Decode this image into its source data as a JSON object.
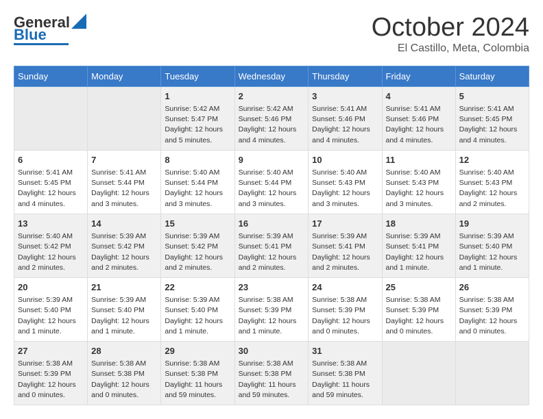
{
  "header": {
    "logo_line1": "General",
    "logo_line2": "Blue",
    "month_title": "October 2024",
    "location": "El Castillo, Meta, Colombia"
  },
  "weekdays": [
    "Sunday",
    "Monday",
    "Tuesday",
    "Wednesday",
    "Thursday",
    "Friday",
    "Saturday"
  ],
  "weeks": [
    [
      {
        "day": "",
        "info": ""
      },
      {
        "day": "",
        "info": ""
      },
      {
        "day": "1",
        "info": "Sunrise: 5:42 AM\nSunset: 5:47 PM\nDaylight: 12 hours and 5 minutes."
      },
      {
        "day": "2",
        "info": "Sunrise: 5:42 AM\nSunset: 5:46 PM\nDaylight: 12 hours and 4 minutes."
      },
      {
        "day": "3",
        "info": "Sunrise: 5:41 AM\nSunset: 5:46 PM\nDaylight: 12 hours and 4 minutes."
      },
      {
        "day": "4",
        "info": "Sunrise: 5:41 AM\nSunset: 5:46 PM\nDaylight: 12 hours and 4 minutes."
      },
      {
        "day": "5",
        "info": "Sunrise: 5:41 AM\nSunset: 5:45 PM\nDaylight: 12 hours and 4 minutes."
      }
    ],
    [
      {
        "day": "6",
        "info": "Sunrise: 5:41 AM\nSunset: 5:45 PM\nDaylight: 12 hours and 4 minutes."
      },
      {
        "day": "7",
        "info": "Sunrise: 5:41 AM\nSunset: 5:44 PM\nDaylight: 12 hours and 3 minutes."
      },
      {
        "day": "8",
        "info": "Sunrise: 5:40 AM\nSunset: 5:44 PM\nDaylight: 12 hours and 3 minutes."
      },
      {
        "day": "9",
        "info": "Sunrise: 5:40 AM\nSunset: 5:44 PM\nDaylight: 12 hours and 3 minutes."
      },
      {
        "day": "10",
        "info": "Sunrise: 5:40 AM\nSunset: 5:43 PM\nDaylight: 12 hours and 3 minutes."
      },
      {
        "day": "11",
        "info": "Sunrise: 5:40 AM\nSunset: 5:43 PM\nDaylight: 12 hours and 3 minutes."
      },
      {
        "day": "12",
        "info": "Sunrise: 5:40 AM\nSunset: 5:43 PM\nDaylight: 12 hours and 2 minutes."
      }
    ],
    [
      {
        "day": "13",
        "info": "Sunrise: 5:40 AM\nSunset: 5:42 PM\nDaylight: 12 hours and 2 minutes."
      },
      {
        "day": "14",
        "info": "Sunrise: 5:39 AM\nSunset: 5:42 PM\nDaylight: 12 hours and 2 minutes."
      },
      {
        "day": "15",
        "info": "Sunrise: 5:39 AM\nSunset: 5:42 PM\nDaylight: 12 hours and 2 minutes."
      },
      {
        "day": "16",
        "info": "Sunrise: 5:39 AM\nSunset: 5:41 PM\nDaylight: 12 hours and 2 minutes."
      },
      {
        "day": "17",
        "info": "Sunrise: 5:39 AM\nSunset: 5:41 PM\nDaylight: 12 hours and 2 minutes."
      },
      {
        "day": "18",
        "info": "Sunrise: 5:39 AM\nSunset: 5:41 PM\nDaylight: 12 hours and 1 minute."
      },
      {
        "day": "19",
        "info": "Sunrise: 5:39 AM\nSunset: 5:40 PM\nDaylight: 12 hours and 1 minute."
      }
    ],
    [
      {
        "day": "20",
        "info": "Sunrise: 5:39 AM\nSunset: 5:40 PM\nDaylight: 12 hours and 1 minute."
      },
      {
        "day": "21",
        "info": "Sunrise: 5:39 AM\nSunset: 5:40 PM\nDaylight: 12 hours and 1 minute."
      },
      {
        "day": "22",
        "info": "Sunrise: 5:39 AM\nSunset: 5:40 PM\nDaylight: 12 hours and 1 minute."
      },
      {
        "day": "23",
        "info": "Sunrise: 5:38 AM\nSunset: 5:39 PM\nDaylight: 12 hours and 1 minute."
      },
      {
        "day": "24",
        "info": "Sunrise: 5:38 AM\nSunset: 5:39 PM\nDaylight: 12 hours and 0 minutes."
      },
      {
        "day": "25",
        "info": "Sunrise: 5:38 AM\nSunset: 5:39 PM\nDaylight: 12 hours and 0 minutes."
      },
      {
        "day": "26",
        "info": "Sunrise: 5:38 AM\nSunset: 5:39 PM\nDaylight: 12 hours and 0 minutes."
      }
    ],
    [
      {
        "day": "27",
        "info": "Sunrise: 5:38 AM\nSunset: 5:39 PM\nDaylight: 12 hours and 0 minutes."
      },
      {
        "day": "28",
        "info": "Sunrise: 5:38 AM\nSunset: 5:38 PM\nDaylight: 12 hours and 0 minutes."
      },
      {
        "day": "29",
        "info": "Sunrise: 5:38 AM\nSunset: 5:38 PM\nDaylight: 11 hours and 59 minutes."
      },
      {
        "day": "30",
        "info": "Sunrise: 5:38 AM\nSunset: 5:38 PM\nDaylight: 11 hours and 59 minutes."
      },
      {
        "day": "31",
        "info": "Sunrise: 5:38 AM\nSunset: 5:38 PM\nDaylight: 11 hours and 59 minutes."
      },
      {
        "day": "",
        "info": ""
      },
      {
        "day": "",
        "info": ""
      }
    ]
  ]
}
